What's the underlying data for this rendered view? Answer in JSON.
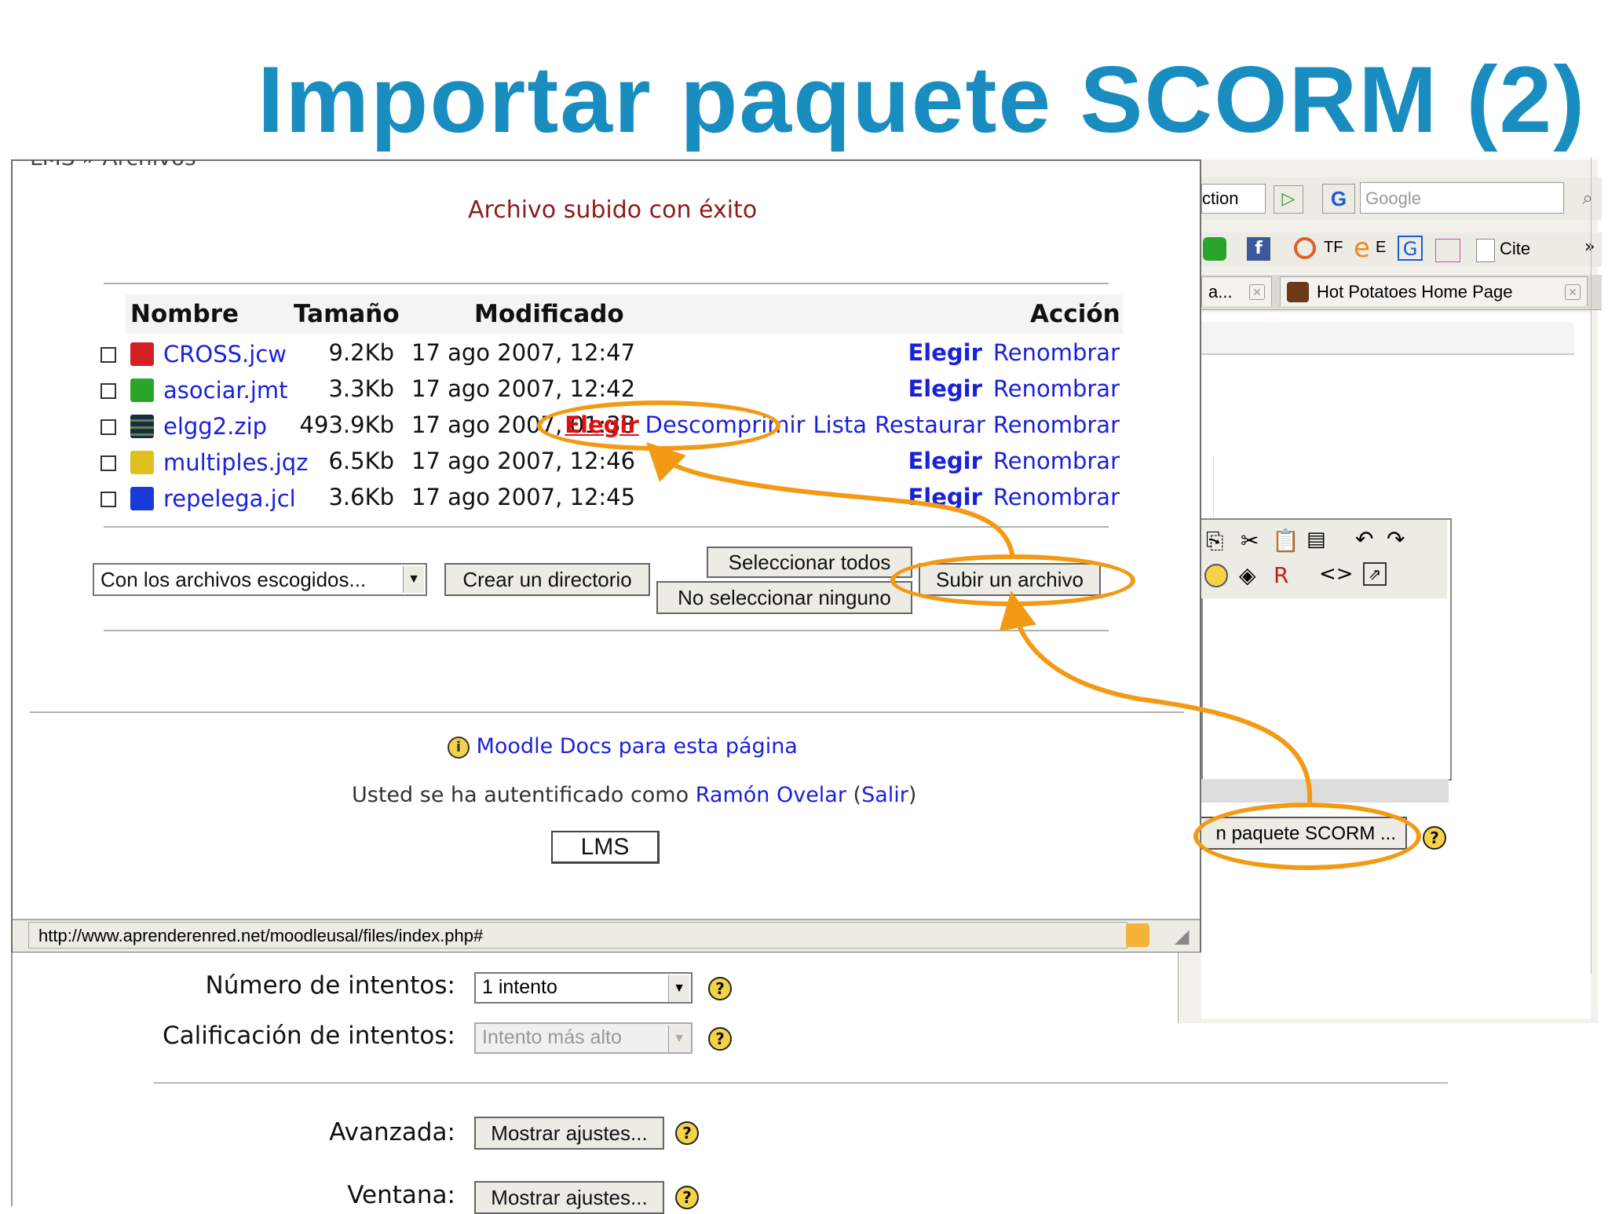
{
  "slide": {
    "title": "Importar paquete SCORM (2)"
  },
  "browser_bg": {
    "toolbar_text": "ction",
    "search_placeholder": "Google",
    "bookmarks": [
      "TF",
      "E",
      "Cite"
    ],
    "tabs": [
      {
        "label": "a..."
      },
      {
        "label": "Hot Potatoes Home Page"
      }
    ],
    "scorm_button_label": "n paquete SCORM ..."
  },
  "popup": {
    "breadcrumb": "LMS » Archivos",
    "success_message": "Archivo subido con éxito",
    "table": {
      "headers": {
        "name": "Nombre",
        "size": "Tamaño",
        "modified": "Modificado",
        "action": "Acción"
      },
      "rows": [
        {
          "name": "CROSS.jcw",
          "size": "9.2Kb",
          "modified": "17 ago 2007, 12:47",
          "icon": "hotpot-cross-icon",
          "color": "#d42020"
        },
        {
          "name": "asociar.jmt",
          "size": "3.3Kb",
          "modified": "17 ago 2007, 12:42",
          "icon": "hotpot-match-icon",
          "color": "#2aa52a"
        },
        {
          "name": "elgg2.zip",
          "size": "493.9Kb",
          "modified": "17 ago 2007, 01:38",
          "icon": "zip-archive-icon",
          "color": "#1a2a4a"
        },
        {
          "name": "multiples.jqz",
          "size": "6.5Kb",
          "modified": "17 ago 2007, 12:46",
          "icon": "hotpot-quiz-icon",
          "color": "#e0c020"
        },
        {
          "name": "repelega.jcl",
          "size": "3.6Kb",
          "modified": "17 ago 2007, 12:45",
          "icon": "hotpot-cloze-icon",
          "color": "#1a3ad8"
        }
      ],
      "actions": {
        "choose": "Elegir",
        "rename": "Renombrar",
        "unzip": "Descomprimir",
        "list": "Lista",
        "restore": "Restaurar"
      }
    },
    "with_selected": "Con los archivos escogidos...",
    "buttons": {
      "create_dir": "Crear un directorio",
      "select_all": "Seleccionar todos",
      "select_none": "No seleccionar ninguno",
      "upload": "Subir un archivo"
    },
    "docs_link": "Moodle Docs para esta página",
    "auth": {
      "prefix": "Usted se ha autentificado como",
      "user": "Ramón Ovelar",
      "open": "(",
      "logout": "Salir",
      "close": ")"
    },
    "home_button": "LMS",
    "status_url": "http://www.aprenderenred.net/moodleusal/files/index.php#"
  },
  "form": {
    "attempts_label": "Número de intentos:",
    "attempts_value": "1 intento",
    "grading_label": "Calificación de intentos:",
    "grading_value": "Intento más alto",
    "advanced_label": "Avanzada:",
    "advanced_button": "Mostrar ajustes...",
    "window_label": "Ventana:",
    "window_button": "Mostrar ajustes..."
  },
  "colors": {
    "title": "#1a8dc0",
    "highlight": "#f29a14",
    "link": "#1a22d8",
    "selected_action": "#e01010"
  }
}
